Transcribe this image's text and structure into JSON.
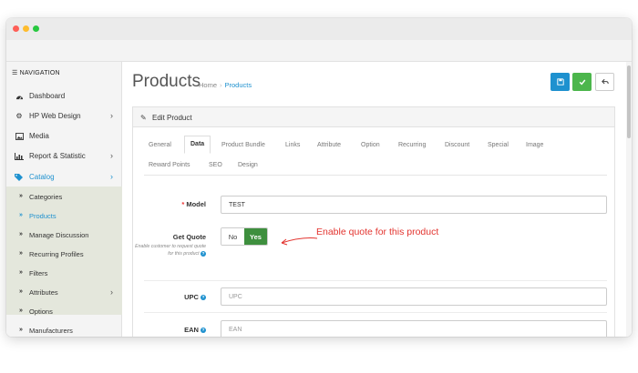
{
  "navigation": {
    "header": "NAVIGATION",
    "items": [
      {
        "label": "Dashboard",
        "icon": "dashboard-icon",
        "glyph": "☗"
      },
      {
        "label": "HP Web Design",
        "icon": "cogs-icon",
        "glyph": "⚙",
        "expandable": true
      },
      {
        "label": "Media",
        "icon": "image-icon",
        "glyph": "▣"
      },
      {
        "label": "Report & Statistic",
        "icon": "bar-chart-icon",
        "glyph": "▥",
        "expandable": true
      },
      {
        "label": "Catalog",
        "icon": "tags-icon",
        "glyph": "◆",
        "expandable": true,
        "active": true
      }
    ],
    "catalog_submenu": [
      {
        "label": "Categories"
      },
      {
        "label": "Products",
        "active": true
      },
      {
        "label": "Manage Discussion"
      },
      {
        "label": "Recurring Profiles"
      },
      {
        "label": "Filters"
      },
      {
        "label": "Attributes",
        "expandable": true
      },
      {
        "label": "Options"
      },
      {
        "label": "Manufacturers"
      }
    ]
  },
  "page": {
    "title": "Products",
    "breadcrumb": {
      "home": "Home",
      "separator": "›",
      "current": "Products"
    }
  },
  "actions": {
    "save_icon": "floppy-icon",
    "apply_icon": "check-icon",
    "back_icon": "reply-icon"
  },
  "panel": {
    "title": "Edit Product",
    "icon": "pencil-icon",
    "tabs": [
      "General",
      "Data",
      "Product Bundle",
      "Links",
      "Attribute",
      "Option",
      "Recurring",
      "Discount",
      "Special",
      "Image",
      "Reward Points",
      "SEO",
      "Design"
    ],
    "active_tab": "Data"
  },
  "form": {
    "model": {
      "label": "Model",
      "required_mark": "*",
      "value": "TEST"
    },
    "get_quote": {
      "label": "Get Quote",
      "help": "Enable customer to request quote for this product",
      "options": {
        "no": "No",
        "yes": "Yes"
      },
      "selected": "Yes"
    },
    "upc": {
      "label": "UPC",
      "placeholder": "UPC"
    },
    "ean": {
      "label": "EAN",
      "placeholder": "EAN"
    }
  },
  "annotation": {
    "text": "Enable quote for this product",
    "color": "#e3342f"
  },
  "colors": {
    "accent": "#1e91cf",
    "success": "#4cb64c",
    "toggle_on": "#3e8f3e",
    "required": "#e33333"
  }
}
